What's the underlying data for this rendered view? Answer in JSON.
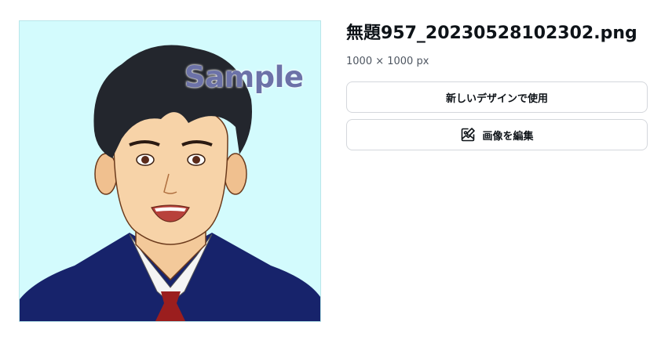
{
  "file": {
    "name": "無題957_20230528102302.png",
    "dimensions": "1000 × 1000 px"
  },
  "preview": {
    "watermark": "Sample",
    "background_color": "#d3fbfd"
  },
  "actions": {
    "use_in_new_design_label": "新しいデザインで使用",
    "edit_image_label": "画像を編集",
    "edit_image_icon": "image-edit-icon"
  }
}
